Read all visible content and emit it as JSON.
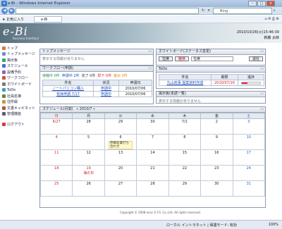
{
  "browser": {
    "title": "e-Bi - Windows Internet Explorer",
    "search_engine": "Bing",
    "favorites_label": "お気に入り",
    "tab_label": "e-Bi",
    "status_zone": "ローカル イントラネット | 保護モード: 有効",
    "zoom": "100%"
  },
  "header": {
    "brand": "e-Bi",
    "subtitle": "Business Interface",
    "date": "2010/10/26(火)15:46:39",
    "user": "新藤 太郎"
  },
  "sidebar": {
    "items": [
      {
        "label": "トップ",
        "color": "#d97b2a"
      },
      {
        "label": "トップメッセージ",
        "color": "#6a8fcf"
      },
      {
        "label": "掲示板",
        "color": "#3fa36b"
      },
      {
        "label": "スケジュール",
        "color": "#3f72c4"
      },
      {
        "label": "設備予約",
        "color": "#8a63c2"
      },
      {
        "label": "ワークフロー",
        "color": "#d1513a"
      },
      {
        "label": "ホワイトボード",
        "color": "#7a7a7a"
      },
      {
        "label": "ToDo",
        "color": "#3aa1b8"
      },
      {
        "label": "社員名簿",
        "color": "#5f8a3c"
      },
      {
        "label": "住所録",
        "color": "#c9963a"
      },
      {
        "label": "文書キャビネット",
        "color": "#b5533a"
      },
      {
        "label": "管理機能",
        "color": "#556070"
      },
      {
        "label": "ログアウト",
        "color": "#cf3d3d"
      }
    ]
  },
  "top_message": {
    "title": "トップメッセージ",
    "empty": "表示する情報がありません"
  },
  "workflow": {
    "title": "ワークフロー(申請)",
    "filters": [
      {
        "label": "待機中 0件",
        "color": "#1f8f3a"
      },
      {
        "label": "申請中 2件",
        "color": "#1a4fbf"
      },
      {
        "label": "完了 0件",
        "color": "#333333"
      },
      {
        "label": "却下 0件",
        "color": "#d0242a"
      },
      {
        "label": "差戻 0件",
        "color": "#e08a1a"
      }
    ],
    "columns": [
      "件名",
      "状況",
      "申請日"
    ],
    "rows": [
      {
        "subject": "ノートパソコン購入",
        "status": "申請中",
        "date": "2010/07/06"
      },
      {
        "subject": "有休申請 7/17",
        "status": "申請中",
        "date": "2010/07/06"
      }
    ]
  },
  "whiteboard": {
    "title": "ホワイトボード(ステータス変更)",
    "statuses": [
      "在席",
      "離席",
      "在席"
    ],
    "action": "退社"
  },
  "todo": {
    "title": "ToDo",
    "columns": [
      "件名",
      "期限",
      "進捗"
    ],
    "rows": [
      {
        "subject": "丸山商事 提案資料作成",
        "due": "2010/07/16",
        "progress": 30
      }
    ]
  },
  "bulletin": {
    "title": "掲示板(未読一覧)",
    "empty": "表示する情報がありません"
  },
  "schedule": {
    "title": "スケジュール(月間)",
    "month_nav": "« 2010/7 »",
    "weekdays": [
      "日",
      "月",
      "火",
      "水",
      "木",
      "金",
      "土"
    ],
    "weeks": [
      [
        "6/27",
        "28",
        "29",
        "30",
        "7/1",
        "2",
        "3"
      ],
      [
        "4",
        "5",
        "6",
        "7",
        "8",
        "9",
        "10"
      ],
      [
        "11",
        "12",
        "13",
        "14",
        "15",
        "16",
        "17"
      ],
      [
        "18",
        "19",
        "20",
        "21",
        "22",
        "23",
        "24"
      ],
      [
        "25",
        "26",
        "27",
        "28",
        "29",
        "30",
        "31"
      ]
    ],
    "holiday_label": "海の日",
    "event": "伊藤産業打ち合わせ"
  },
  "footer": {
    "copyright": "Copyright © 2008 ecoc A.T.S. Co.,Ltd. All rights reserved."
  }
}
